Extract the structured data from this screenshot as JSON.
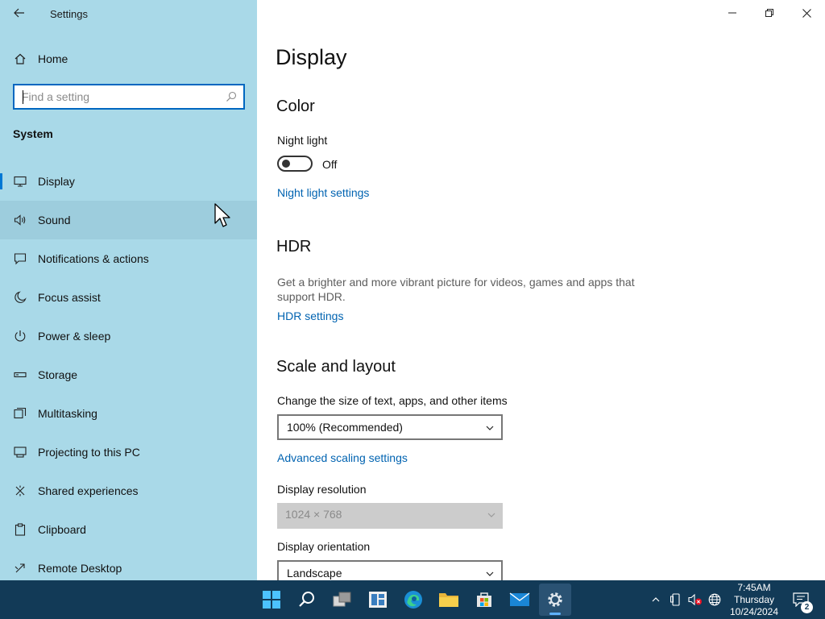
{
  "window": {
    "title": "Settings"
  },
  "sidebar": {
    "home_label": "Home",
    "search": {
      "placeholder": "Find a setting",
      "value": ""
    },
    "section_title": "System",
    "items": [
      {
        "label": "Display",
        "icon": "monitor-icon",
        "active": true
      },
      {
        "label": "Sound",
        "icon": "speaker-icon",
        "hovered": true
      },
      {
        "label": "Notifications & actions",
        "icon": "notification-icon"
      },
      {
        "label": "Focus assist",
        "icon": "moon-icon"
      },
      {
        "label": "Power & sleep",
        "icon": "power-icon"
      },
      {
        "label": "Storage",
        "icon": "storage-icon"
      },
      {
        "label": "Multitasking",
        "icon": "multitasking-icon"
      },
      {
        "label": "Projecting to this PC",
        "icon": "projecting-icon"
      },
      {
        "label": "Shared experiences",
        "icon": "shared-experiences-icon"
      },
      {
        "label": "Clipboard",
        "icon": "clipboard-icon"
      },
      {
        "label": "Remote Desktop",
        "icon": "remote-desktop-icon"
      }
    ]
  },
  "main": {
    "page_title": "Display",
    "color": {
      "heading": "Color",
      "night_light_label": "Night light",
      "night_light_state": "Off",
      "night_light_link": "Night light settings"
    },
    "hdr": {
      "heading": "HDR",
      "description": "Get a brighter and more vibrant picture for videos, games and apps that support HDR.",
      "link": "HDR settings"
    },
    "scale": {
      "heading": "Scale and layout",
      "size_label": "Change the size of text, apps, and other items",
      "size_value": "100% (Recommended)",
      "advanced_link": "Advanced scaling settings",
      "resolution_label": "Display resolution",
      "resolution_value": "1024 × 768",
      "orientation_label": "Display orientation",
      "orientation_value": "Landscape"
    }
  },
  "taskbar": {
    "apps": [
      "start-icon",
      "search-icon",
      "task-view-icon",
      "widgets-icon",
      "edge-icon",
      "file-explorer-icon",
      "store-icon",
      "mail-icon",
      "settings-icon"
    ],
    "active_app": "settings-icon",
    "clock": {
      "time": "7:45AM",
      "day": "Thursday",
      "date": "10/24/2024"
    },
    "notification_count": "2"
  },
  "colors": {
    "sidebar_bg": "#a9d9e8",
    "accent": "#0078d4",
    "link": "#0063b1",
    "taskbar_bg": "#123a57"
  }
}
